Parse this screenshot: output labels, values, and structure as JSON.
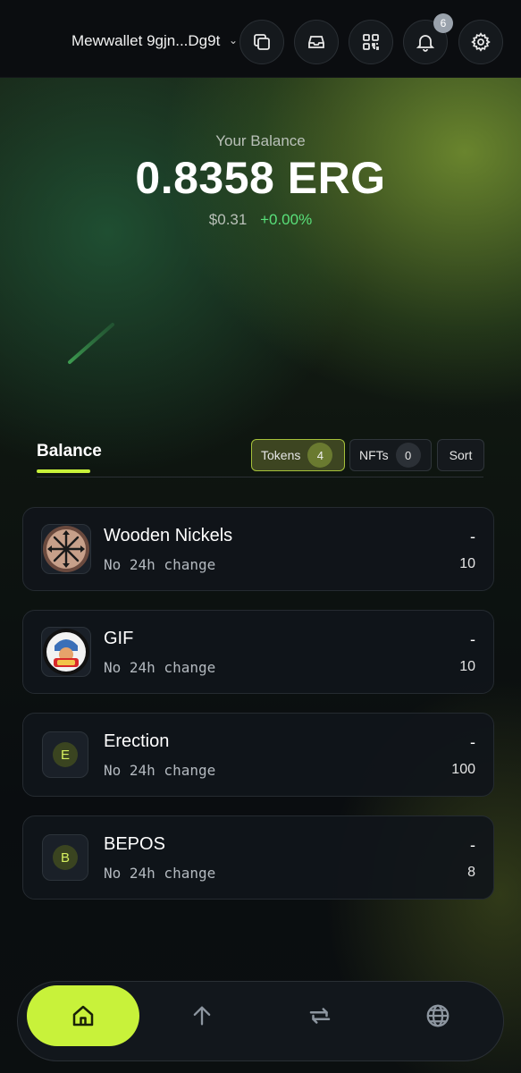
{
  "header": {
    "wallet_name": "Mewwallet 9gjn...Dg9t",
    "notification_count": "6",
    "icons": [
      "copy-icon",
      "inbox-icon",
      "qr-code-icon",
      "bell-icon",
      "gear-icon"
    ]
  },
  "balance": {
    "label": "Your Balance",
    "amount": "0.8358 ERG",
    "fiat": "$0.31",
    "change": "+0.00%"
  },
  "tabs": {
    "balance_label": "Balance",
    "tokens_label": "Tokens",
    "tokens_count": "4",
    "nfts_label": "NFTs",
    "nfts_count": "0",
    "sort_label": "Sort"
  },
  "tokens": [
    {
      "name": "Wooden Nickels",
      "change": "No 24h change",
      "dash": "-",
      "amount": "10",
      "icon": "wooden-nickels-icon"
    },
    {
      "name": "GIF",
      "change": "No 24h change",
      "dash": "-",
      "amount": "10",
      "icon": "gif-token-icon"
    },
    {
      "name": "Erection",
      "change": "No 24h change",
      "dash": "-",
      "amount": "100",
      "letter": "E"
    },
    {
      "name": "BEPOS",
      "change": "No 24h change",
      "dash": "-",
      "amount": "8",
      "letter": "B"
    }
  ],
  "bottom_nav": {
    "items": [
      "home-icon",
      "send-arrow-icon",
      "swap-icon",
      "globe-icon"
    ]
  },
  "colors": {
    "accent": "#c8f23a",
    "positive": "#59e07a",
    "background": "#0b0f12"
  }
}
